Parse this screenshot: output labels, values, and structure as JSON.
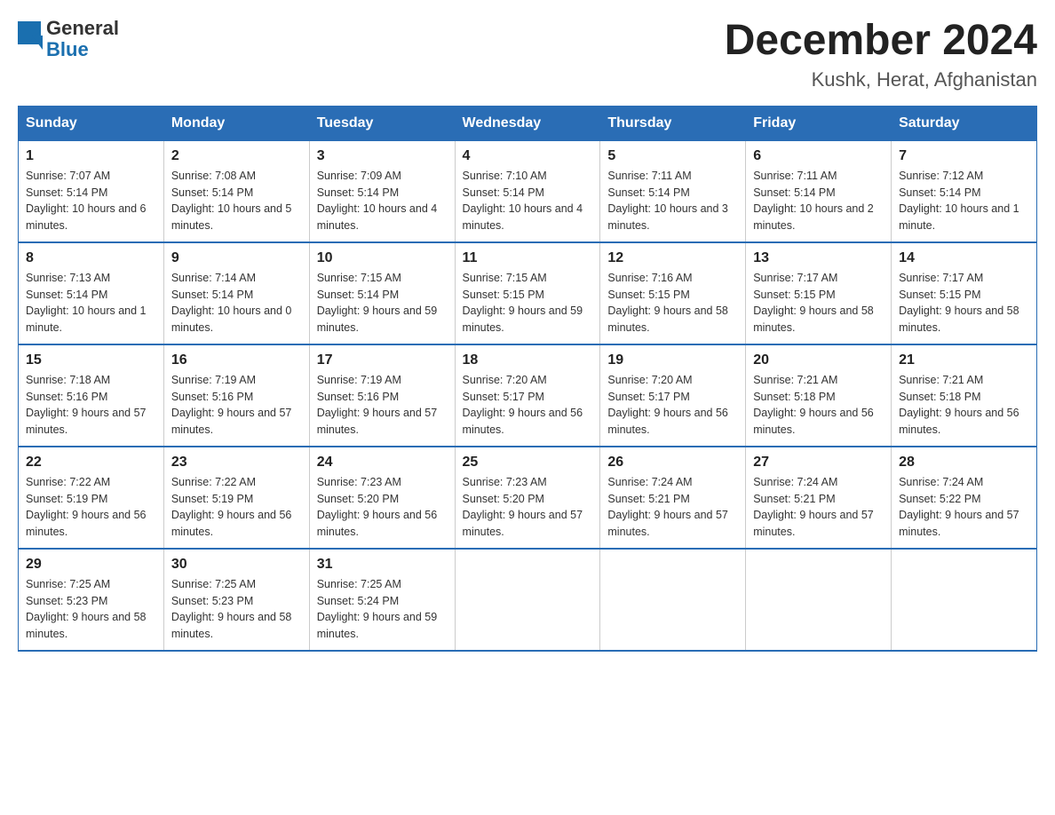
{
  "header": {
    "logo_line1": "General",
    "logo_line2": "Blue",
    "month_title": "December 2024",
    "location": "Kushk, Herat, Afghanistan"
  },
  "days_of_week": [
    "Sunday",
    "Monday",
    "Tuesday",
    "Wednesday",
    "Thursday",
    "Friday",
    "Saturday"
  ],
  "weeks": [
    [
      {
        "num": "1",
        "sunrise": "7:07 AM",
        "sunset": "5:14 PM",
        "daylight": "10 hours and 6 minutes."
      },
      {
        "num": "2",
        "sunrise": "7:08 AM",
        "sunset": "5:14 PM",
        "daylight": "10 hours and 5 minutes."
      },
      {
        "num": "3",
        "sunrise": "7:09 AM",
        "sunset": "5:14 PM",
        "daylight": "10 hours and 4 minutes."
      },
      {
        "num": "4",
        "sunrise": "7:10 AM",
        "sunset": "5:14 PM",
        "daylight": "10 hours and 4 minutes."
      },
      {
        "num": "5",
        "sunrise": "7:11 AM",
        "sunset": "5:14 PM",
        "daylight": "10 hours and 3 minutes."
      },
      {
        "num": "6",
        "sunrise": "7:11 AM",
        "sunset": "5:14 PM",
        "daylight": "10 hours and 2 minutes."
      },
      {
        "num": "7",
        "sunrise": "7:12 AM",
        "sunset": "5:14 PM",
        "daylight": "10 hours and 1 minute."
      }
    ],
    [
      {
        "num": "8",
        "sunrise": "7:13 AM",
        "sunset": "5:14 PM",
        "daylight": "10 hours and 1 minute."
      },
      {
        "num": "9",
        "sunrise": "7:14 AM",
        "sunset": "5:14 PM",
        "daylight": "10 hours and 0 minutes."
      },
      {
        "num": "10",
        "sunrise": "7:15 AM",
        "sunset": "5:14 PM",
        "daylight": "9 hours and 59 minutes."
      },
      {
        "num": "11",
        "sunrise": "7:15 AM",
        "sunset": "5:15 PM",
        "daylight": "9 hours and 59 minutes."
      },
      {
        "num": "12",
        "sunrise": "7:16 AM",
        "sunset": "5:15 PM",
        "daylight": "9 hours and 58 minutes."
      },
      {
        "num": "13",
        "sunrise": "7:17 AM",
        "sunset": "5:15 PM",
        "daylight": "9 hours and 58 minutes."
      },
      {
        "num": "14",
        "sunrise": "7:17 AM",
        "sunset": "5:15 PM",
        "daylight": "9 hours and 58 minutes."
      }
    ],
    [
      {
        "num": "15",
        "sunrise": "7:18 AM",
        "sunset": "5:16 PM",
        "daylight": "9 hours and 57 minutes."
      },
      {
        "num": "16",
        "sunrise": "7:19 AM",
        "sunset": "5:16 PM",
        "daylight": "9 hours and 57 minutes."
      },
      {
        "num": "17",
        "sunrise": "7:19 AM",
        "sunset": "5:16 PM",
        "daylight": "9 hours and 57 minutes."
      },
      {
        "num": "18",
        "sunrise": "7:20 AM",
        "sunset": "5:17 PM",
        "daylight": "9 hours and 56 minutes."
      },
      {
        "num": "19",
        "sunrise": "7:20 AM",
        "sunset": "5:17 PM",
        "daylight": "9 hours and 56 minutes."
      },
      {
        "num": "20",
        "sunrise": "7:21 AM",
        "sunset": "5:18 PM",
        "daylight": "9 hours and 56 minutes."
      },
      {
        "num": "21",
        "sunrise": "7:21 AM",
        "sunset": "5:18 PM",
        "daylight": "9 hours and 56 minutes."
      }
    ],
    [
      {
        "num": "22",
        "sunrise": "7:22 AM",
        "sunset": "5:19 PM",
        "daylight": "9 hours and 56 minutes."
      },
      {
        "num": "23",
        "sunrise": "7:22 AM",
        "sunset": "5:19 PM",
        "daylight": "9 hours and 56 minutes."
      },
      {
        "num": "24",
        "sunrise": "7:23 AM",
        "sunset": "5:20 PM",
        "daylight": "9 hours and 56 minutes."
      },
      {
        "num": "25",
        "sunrise": "7:23 AM",
        "sunset": "5:20 PM",
        "daylight": "9 hours and 57 minutes."
      },
      {
        "num": "26",
        "sunrise": "7:24 AM",
        "sunset": "5:21 PM",
        "daylight": "9 hours and 57 minutes."
      },
      {
        "num": "27",
        "sunrise": "7:24 AM",
        "sunset": "5:21 PM",
        "daylight": "9 hours and 57 minutes."
      },
      {
        "num": "28",
        "sunrise": "7:24 AM",
        "sunset": "5:22 PM",
        "daylight": "9 hours and 57 minutes."
      }
    ],
    [
      {
        "num": "29",
        "sunrise": "7:25 AM",
        "sunset": "5:23 PM",
        "daylight": "9 hours and 58 minutes."
      },
      {
        "num": "30",
        "sunrise": "7:25 AM",
        "sunset": "5:23 PM",
        "daylight": "9 hours and 58 minutes."
      },
      {
        "num": "31",
        "sunrise": "7:25 AM",
        "sunset": "5:24 PM",
        "daylight": "9 hours and 59 minutes."
      },
      null,
      null,
      null,
      null
    ]
  ],
  "labels": {
    "sunrise_prefix": "Sunrise: ",
    "sunset_prefix": "Sunset: ",
    "daylight_prefix": "Daylight: "
  }
}
